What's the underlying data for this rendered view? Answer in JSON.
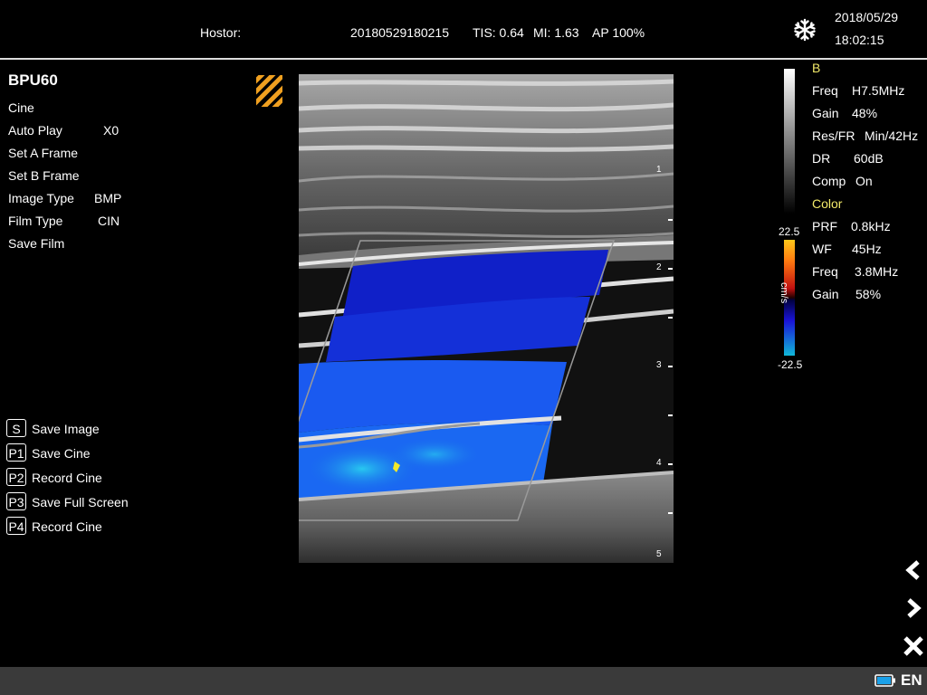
{
  "header": {
    "hospital_label": "Hostor:",
    "exam_id": "20180529180215",
    "tis": "TIS: 0.64",
    "mi": "MI: 1.63",
    "ap": "AP 100%",
    "date": "2018/05/29",
    "time": "18:02:15",
    "freeze_icon": "snowflake-icon"
  },
  "menu": {
    "title": "BPU60",
    "items": [
      {
        "label": "Cine",
        "value": ""
      },
      {
        "label": "Auto Play",
        "value": "X0"
      },
      {
        "label": "Set A Frame",
        "value": ""
      },
      {
        "label": "Set B Frame",
        "value": ""
      },
      {
        "label": "Image Type",
        "value": "BMP"
      },
      {
        "label": "Film Type",
        "value": "CIN"
      },
      {
        "label": "Save Film",
        "value": ""
      }
    ]
  },
  "shortcuts": [
    {
      "key": "S",
      "label": "Save Image"
    },
    {
      "key": "P1",
      "label": "Save Cine"
    },
    {
      "key": "P2",
      "label": "Record Cine"
    },
    {
      "key": "P3",
      "label": "Save Full Screen"
    },
    {
      "key": "P4",
      "label": "Record Cine"
    }
  ],
  "image": {
    "depth_marks": [
      "1",
      "2",
      "3",
      "4",
      "5"
    ]
  },
  "params": {
    "b_title": "B",
    "b": [
      {
        "label": "Freq",
        "value": "H7.5MHz"
      },
      {
        "label": "Gain",
        "value": "48%"
      },
      {
        "label": "Res/FR",
        "value": "Min/42Hz"
      },
      {
        "label": "DR",
        "value": "60dB"
      },
      {
        "label": "Comp",
        "value": "On"
      }
    ],
    "color_title": "Color",
    "color": [
      {
        "label": "PRF",
        "value": "0.8kHz"
      },
      {
        "label": "WF",
        "value": "45Hz"
      },
      {
        "label": "Freq",
        "value": "3.8MHz"
      },
      {
        "label": "Gain",
        "value": "58%"
      }
    ],
    "color_scale_max": "22.5",
    "color_scale_min": "-22.5",
    "color_scale_unit": "cm/s"
  },
  "footer": {
    "language": "EN",
    "battery_icon": "battery-icon"
  },
  "colors": {
    "background": "#000000",
    "section_title": "#f2ea6a",
    "footer": "#3a3a3a",
    "probe_marker": "#f0a020"
  }
}
